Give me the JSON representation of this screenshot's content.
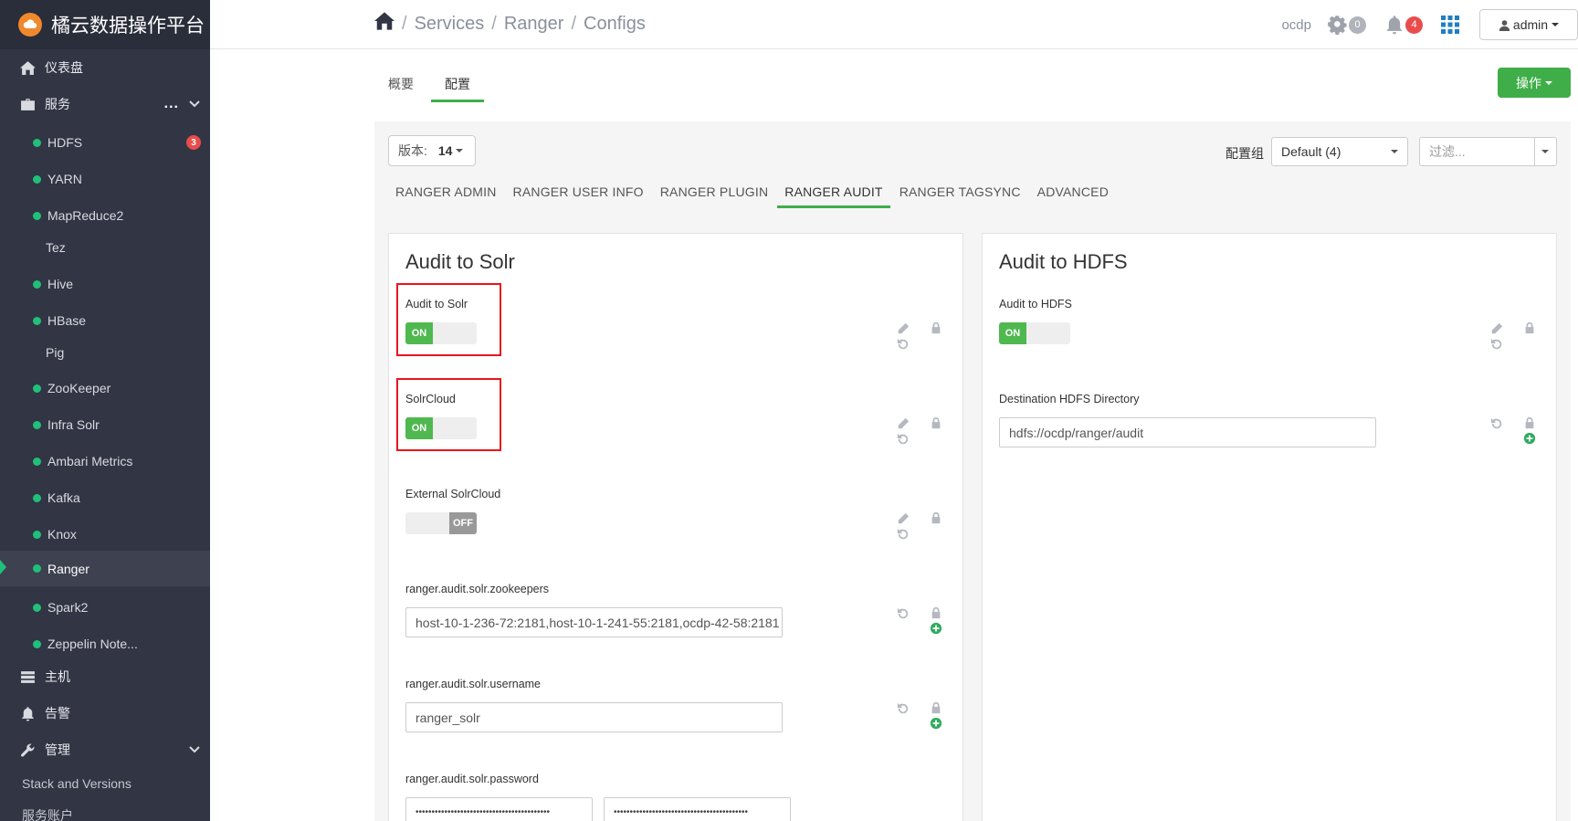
{
  "brand": {
    "name": "橘云数据操作平台"
  },
  "sidebar": {
    "dashboard": "仪表盘",
    "services": "服务",
    "items": [
      {
        "label": "HDFS",
        "dot": true,
        "badge": "3"
      },
      {
        "label": "YARN",
        "dot": true
      },
      {
        "label": "MapReduce2",
        "dot": true
      },
      {
        "label": "Tez",
        "dot": false
      },
      {
        "label": "Hive",
        "dot": true
      },
      {
        "label": "HBase",
        "dot": true
      },
      {
        "label": "Pig",
        "dot": false
      },
      {
        "label": "ZooKeeper",
        "dot": true
      },
      {
        "label": "Infra Solr",
        "dot": true
      },
      {
        "label": "Ambari Metrics",
        "dot": true
      },
      {
        "label": "Kafka",
        "dot": true
      },
      {
        "label": "Knox",
        "dot": true
      },
      {
        "label": "Ranger",
        "dot": true,
        "active": true
      },
      {
        "label": "Spark2",
        "dot": true
      },
      {
        "label": "Zeppelin Note...",
        "dot": true
      }
    ],
    "hosts": "主机",
    "alerts": "告警",
    "admin": "管理",
    "stack_versions": "Stack and Versions",
    "service_accounts": "服务账户"
  },
  "header": {
    "breadcrumb": [
      "Services",
      "Ranger",
      "Configs"
    ],
    "cluster": "ocdp",
    "ops_count": "0",
    "alerts_count": "4",
    "user": "admin"
  },
  "page_tabs": {
    "summary": "概要",
    "configs": "配置"
  },
  "action_button": "操作",
  "toolbar": {
    "version_label": "版本:",
    "version_value": "14",
    "config_group_label": "配置组",
    "config_group_value": "Default (4)",
    "filter_placeholder": "过滤..."
  },
  "sub_tabs": [
    "RANGER ADMIN",
    "RANGER USER INFO",
    "RANGER PLUGIN",
    "RANGER AUDIT",
    "RANGER TAGSYNC",
    "ADVANCED"
  ],
  "active_sub_tab": "RANGER AUDIT",
  "solr_section": {
    "title": "Audit to Solr",
    "audit_to_solr_label": "Audit to Solr",
    "audit_to_solr_state": "ON",
    "solrcloud_label": "SolrCloud",
    "solrcloud_state": "ON",
    "external_solrcloud_label": "External SolrCloud",
    "external_solrcloud_state": "OFF",
    "zookeepers_label": "ranger.audit.solr.zookeepers",
    "zookeepers_value": "host-10-1-236-72:2181,host-10-1-241-55:2181,ocdp-42-58:2181",
    "username_label": "ranger.audit.solr.username",
    "username_value": "ranger_solr",
    "password_label": "ranger.audit.solr.password",
    "password_mask": "••••••••••••••••••••••••••••••••••••••••••",
    "password_confirm_mask": "••••••••••••••••••••••••••••••••••••••••••"
  },
  "hdfs_section": {
    "title": "Audit to HDFS",
    "audit_to_hdfs_label": "Audit to HDFS",
    "audit_to_hdfs_state": "ON",
    "dest_dir_label": "Destination HDFS Directory",
    "dest_dir_value": "hdfs://ocdp/ranger/audit"
  },
  "colors": {
    "sidebar_bg": "#323544",
    "accent_green": "#3fae49",
    "status_dot": "#20c07a",
    "badge_red": "#e84c4c",
    "highlight_box": "#e8151b"
  }
}
